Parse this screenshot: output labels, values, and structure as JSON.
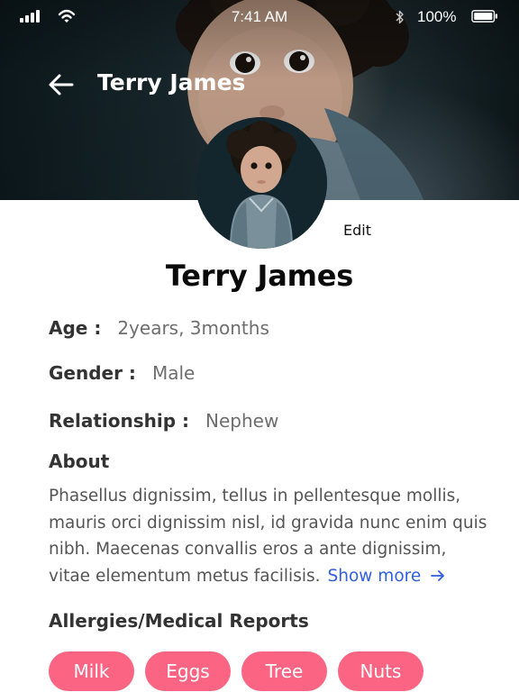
{
  "status_bar": {
    "time": "7:41 AM",
    "battery": "100%"
  },
  "nav": {
    "title": "Terry James"
  },
  "profile": {
    "edit_label": "Edit",
    "name": "Terry James",
    "age_label": "Age :",
    "age_value": "2years, 3months",
    "gender_label": "Gender :",
    "gender_value": "Male",
    "relationship_label": "Relationship :",
    "relationship_value": "Nephew"
  },
  "about": {
    "title": "About",
    "lines": [
      "Phasellus dignissim, tellus in pellentesque mollis,",
      "mauris orci dignissim nisl, id gravida nunc enim quis",
      "nibh. Maecenas convallis eros a ante dignissim,",
      "vitae elementum metus facilisis."
    ],
    "show_more": "Show more"
  },
  "allergies": {
    "title": "Allergies/Medical Reports",
    "chips": [
      "Milk",
      "Eggs",
      "Tree",
      "Nuts"
    ]
  },
  "colors": {
    "chip": "#fb6583",
    "link": "#2f5fe0",
    "header_dark": "#1a2a30"
  },
  "icons": {
    "back": "arrow-left-icon",
    "show_more": "arrow-right-icon",
    "signal": "signal-icon",
    "wifi": "wifi-icon",
    "bluetooth": "bluetooth-icon",
    "battery": "battery-icon"
  }
}
